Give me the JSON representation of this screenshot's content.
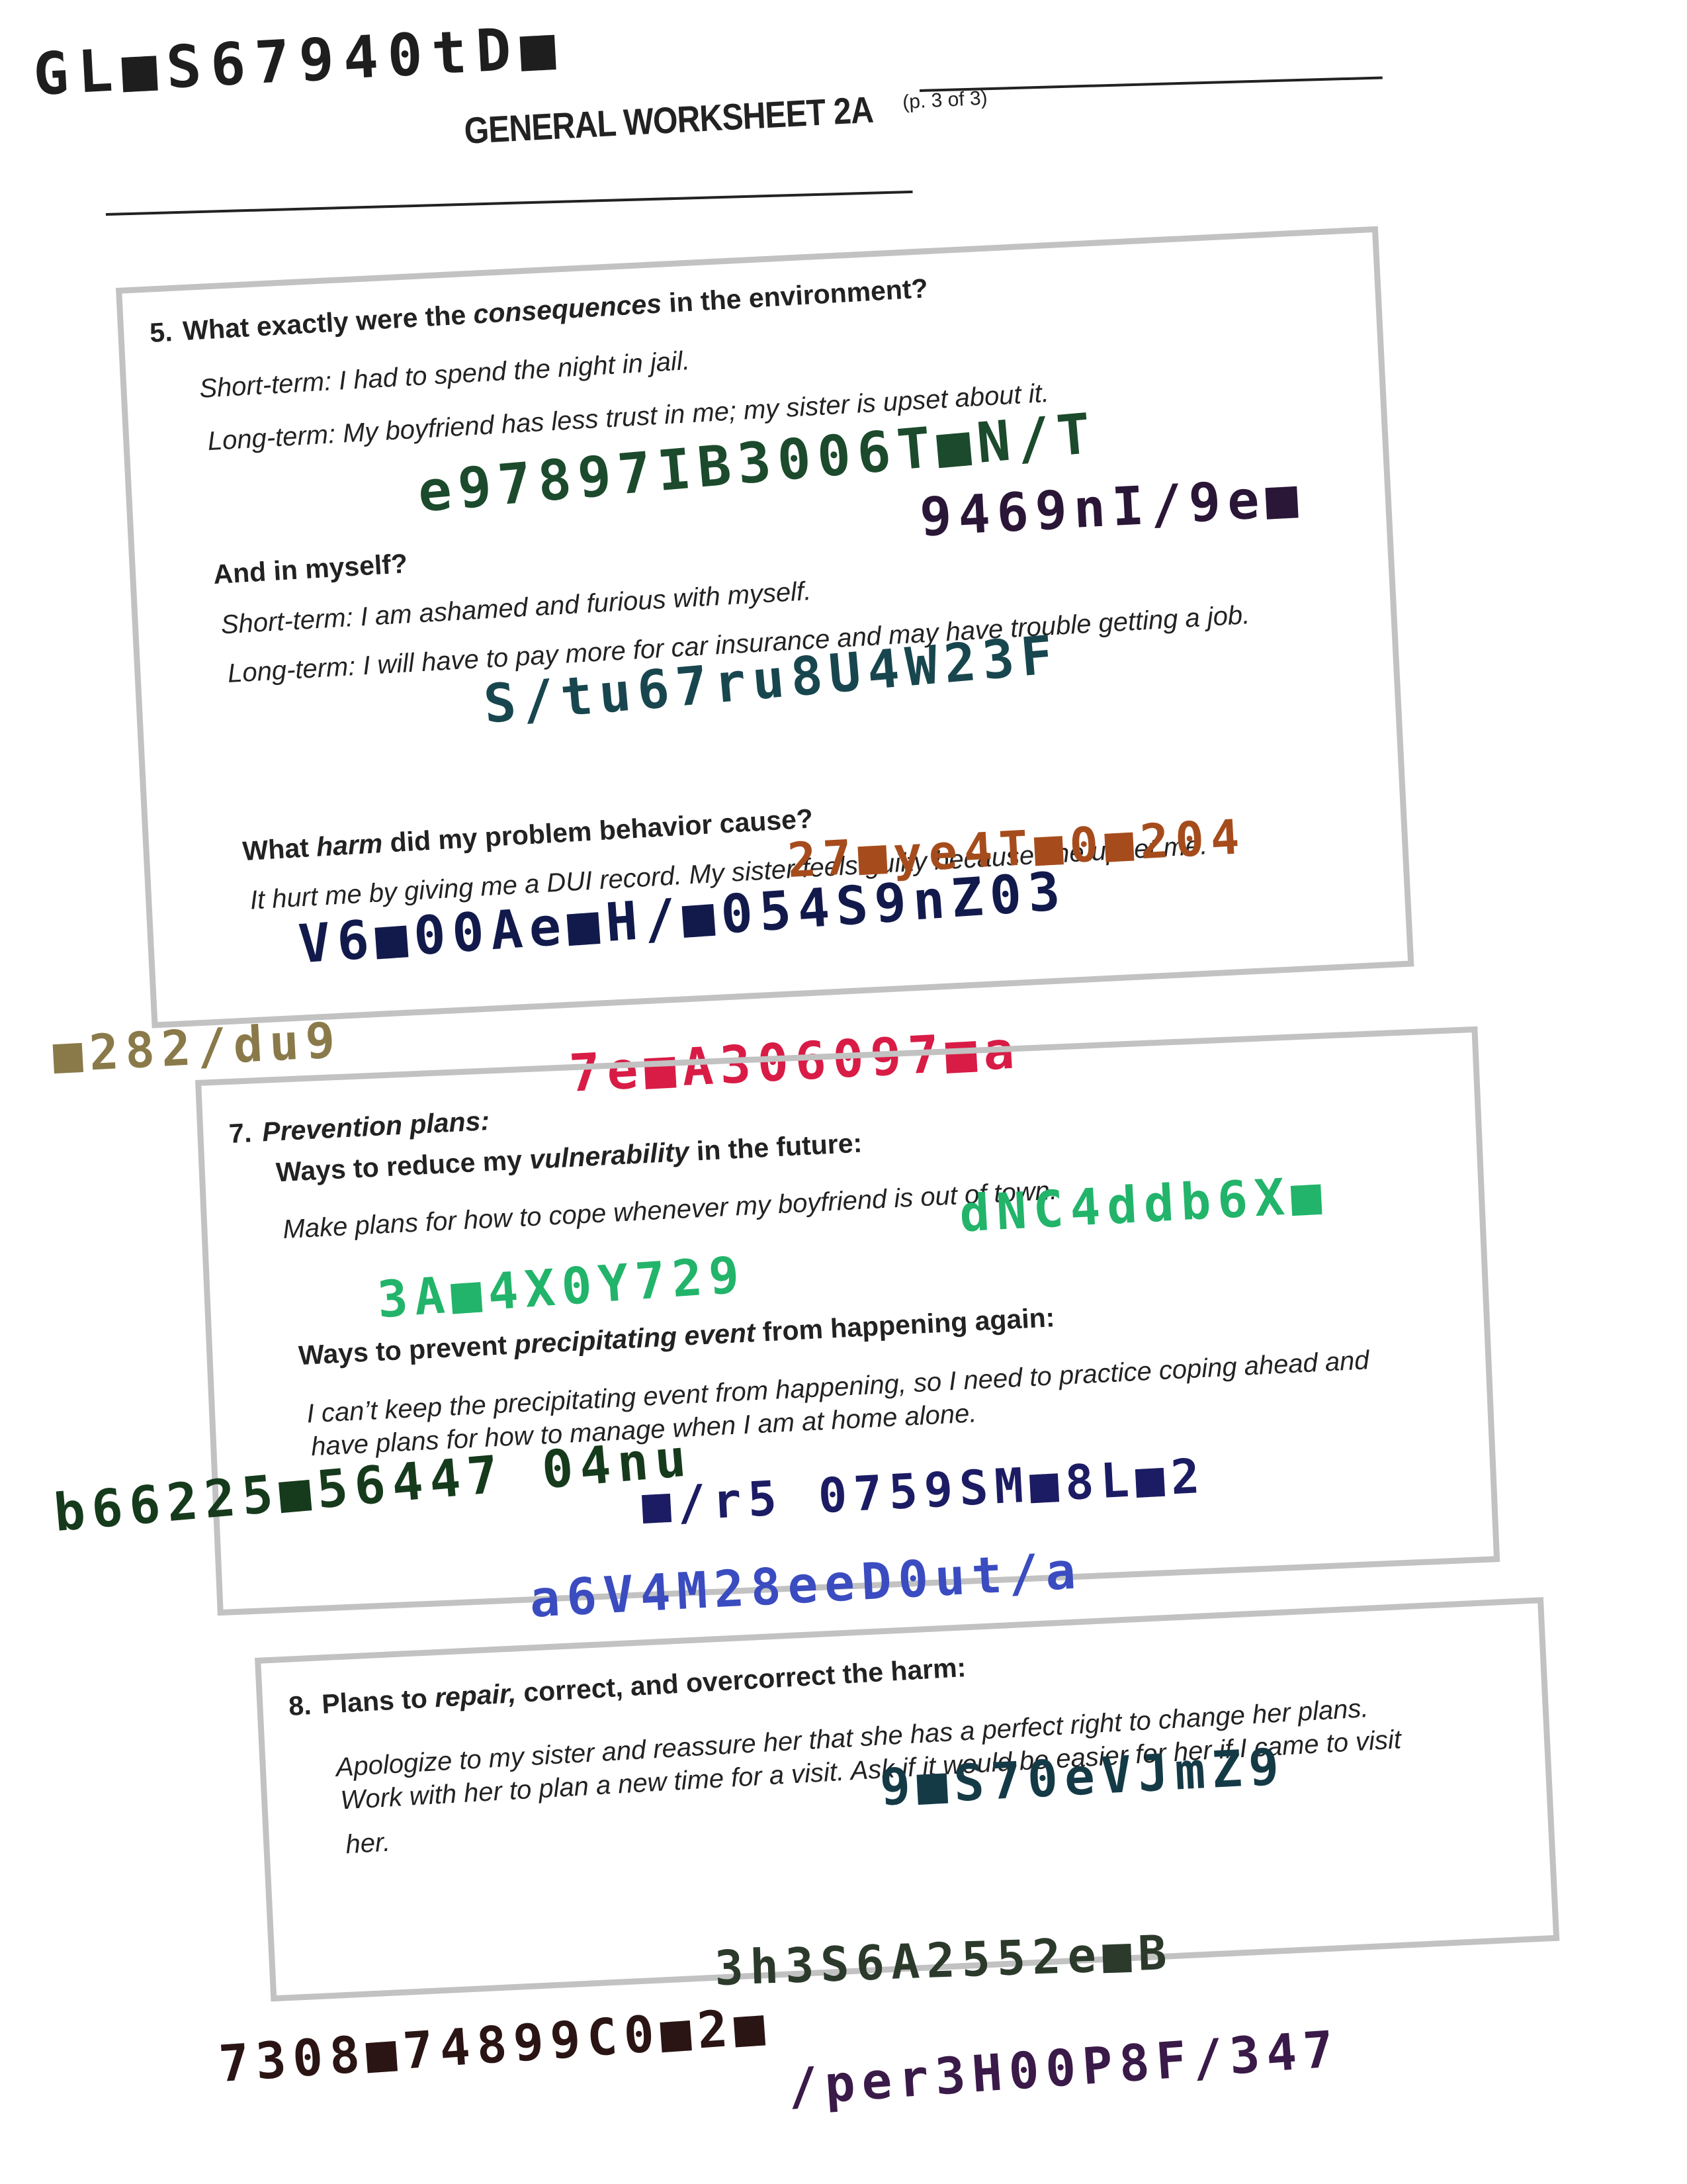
{
  "header": {
    "title": "GENERAL WORKSHEET 2A",
    "subtitle": "(p. 3 of 3)"
  },
  "q5": {
    "number": "5.",
    "heading_pre": "What exactly were the ",
    "heading_em": "consequences",
    "heading_post": " in the environment?",
    "env_short": "Short-term: I had to spend the night in jail.",
    "env_long": "Long-term: My boyfriend has less trust in me; my sister is upset about it.",
    "self_heading": "And in myself?",
    "self_short": "Short-term: I am ashamed and furious with myself.",
    "self_long": "Long-term: I will have to pay more for car insurance and may have trouble getting a job.",
    "harm_pre": "What ",
    "harm_em": "harm",
    "harm_post": " did my problem behavior cause?",
    "harm_answer": "It hurt me by giving me a DUI record. My sister feels guilty because she upset me."
  },
  "q7": {
    "number": "7.",
    "heading": "Prevention plans:",
    "vuln_pre": "Ways to reduce my ",
    "vuln_em": "vulnerability",
    "vuln_post": " in the future:",
    "vuln_answer": "Make plans for how to cope whenever my boyfriend is out of town.",
    "prec_pre": "Ways to prevent ",
    "prec_em": "precipitating event",
    "prec_post": " from happening again:",
    "prec_answer_1": "I can’t keep the precipitating event from happening, so I need to practice coping ahead and",
    "prec_answer_2": "have plans for how to manage when I am at home alone."
  },
  "q8": {
    "number": "8.",
    "heading_pre": "Plans to ",
    "heading_em": "repair,",
    "heading_post": " correct, and overcorrect the harm:",
    "answer_1": "Apologize to my sister and reassure her that she has a perfect right to change her plans.",
    "answer_2": "Work with her to plan a new time for a visit. Ask if it would be easier for her if I came to visit",
    "answer_3": "her."
  },
  "handwriting": {
    "h01": "GL■S67940tD■",
    "h02": "e97897IB3006T■N/T",
    "h03": "9469nI/9e■",
    "h04": "S/tu67ru8U4W23F",
    "h05": "27■ye4T■0■204",
    "h06": "V6■00Ae■H/■054S9nZ03",
    "h07": "■282/du9",
    "h08": "7e■A306097■a",
    "h09": "dNC4ddb6X■",
    "h10": "3A■4X0Y729",
    "h11": "b66225■56447 04nu",
    "h12": "■/r5 0759SM■8L■2",
    "h13": "a6V4M28eeD0ut/a",
    "h14": "9■S70eVJmZ9",
    "h15": "3h3S6A2552e■B",
    "h16": "7308■74899C0■2■",
    "h17": "/per3H00P8F/347"
  },
  "colors": {
    "ink_black": "#1e1e1e",
    "ink_dark_green": "#1c4a2c",
    "ink_purple_dark": "#2a1636",
    "ink_teal": "#18464e",
    "ink_orange_brown": "#a64c1c",
    "ink_navy": "#121a4c",
    "ink_olive": "#8a7a4a",
    "ink_crimson": "#d81c46",
    "ink_green": "#22b46a",
    "ink_forest": "#163a1c",
    "ink_blue_dark": "#1c1c64",
    "ink_blue": "#3a4cc0",
    "ink_dark_teal": "#143a46",
    "ink_grey_green": "#2c3a2c",
    "ink_dark_brown": "#2a1414",
    "ink_violet": "#3a1a48",
    "panel_border": "#c2c2c2"
  }
}
